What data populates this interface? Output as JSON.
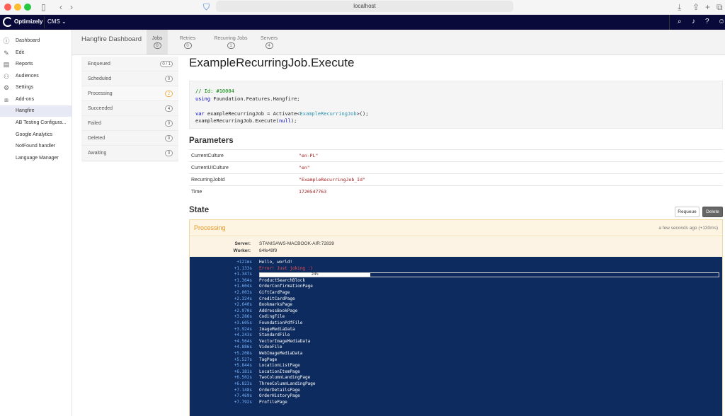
{
  "browser": {
    "address": "localhost"
  },
  "topnav": {
    "brand": "Optimizely",
    "product": "CMS"
  },
  "sidebar": {
    "items": [
      {
        "label": "Dashboard",
        "icon": "info-icon"
      },
      {
        "label": "Edit",
        "icon": "edit-icon"
      },
      {
        "label": "Reports",
        "icon": "chart-icon"
      },
      {
        "label": "Audiences",
        "icon": "people-icon"
      },
      {
        "label": "Settings",
        "icon": "gear-icon"
      },
      {
        "label": "Add-ons",
        "icon": "puzzle-icon"
      },
      {
        "label": "Hangfire",
        "icon": ""
      },
      {
        "label": "AB Testing Configura...",
        "icon": ""
      },
      {
        "label": "Google Analytics",
        "icon": ""
      },
      {
        "label": "NotFound handler",
        "icon": ""
      },
      {
        "label": "Language Manager",
        "icon": ""
      }
    ]
  },
  "hangfire": {
    "brand": "Hangfire Dashboard",
    "tabs": [
      {
        "label": "Jobs",
        "count": "0"
      },
      {
        "label": "Retries",
        "count": "0"
      },
      {
        "label": "Recurring Jobs",
        "count": "1"
      },
      {
        "label": "Servers",
        "count": "4"
      }
    ]
  },
  "jobs_menu": [
    {
      "label": "Enqueued",
      "count": "0 / 1"
    },
    {
      "label": "Scheduled",
      "count": "0"
    },
    {
      "label": "Processing",
      "count": "2"
    },
    {
      "label": "Succeeded",
      "count": "4"
    },
    {
      "label": "Failed",
      "count": "0"
    },
    {
      "label": "Deleted",
      "count": "0"
    },
    {
      "label": "Awaiting",
      "count": "0"
    }
  ],
  "job": {
    "title": "ExampleRecurringJob.Execute",
    "code": {
      "comment": "// Id: #10004",
      "using_kw": "using",
      "using_ns": " Foundation.Features.Hangfire;",
      "var_kw": "var",
      "var_rest1": " exampleRecurringJob = Activate<",
      "var_type": "ExampleRecurringJob",
      "var_rest2": ">();",
      "exec_1": "exampleRecurringJob.Execute(",
      "exec_null": "null",
      "exec_2": ");"
    },
    "parameters_heading": "Parameters",
    "parameters": [
      {
        "key": "CurrentCulture",
        "value": "\"en-PL\""
      },
      {
        "key": "CurrentUICulture",
        "value": "\"en\""
      },
      {
        "key": "RecurringJobId",
        "value": "\"ExampleRecurringJob_Id\""
      },
      {
        "key": "Time",
        "value": "1720547763"
      }
    ],
    "state_heading": "State",
    "requeue_label": "Requeue",
    "delete_label": "Delete",
    "state": {
      "name": "Processing",
      "time": "a few seconds ago (+130ms)",
      "server_label": "Server:",
      "server_value": "STANISAWS-MACBOOK-AIR:72839",
      "worker_label": "Worker:",
      "worker_value": "84fe49f9"
    },
    "console": [
      {
        "ts": "+121ms",
        "text": "Hello, world!",
        "type": "text"
      },
      {
        "ts": "+1.133s",
        "text": "Error! Just joking :)",
        "type": "error"
      },
      {
        "ts": "+1.347s",
        "text": "24%",
        "type": "progress",
        "progress": 24
      },
      {
        "ts": "+1.364s",
        "text": "ProductSearchBlock",
        "type": "text"
      },
      {
        "ts": "+1.604s",
        "text": "OrderConfirmationPage",
        "type": "text"
      },
      {
        "ts": "+2.003s",
        "text": "GiftCardPage",
        "type": "text"
      },
      {
        "ts": "+2.324s",
        "text": "CreditCardPage",
        "type": "text"
      },
      {
        "ts": "+2.640s",
        "text": "BookmarksPage",
        "type": "text"
      },
      {
        "ts": "+2.970s",
        "text": "AddressBookPage",
        "type": "text"
      },
      {
        "ts": "+3.286s",
        "text": "CodingFile",
        "type": "text"
      },
      {
        "ts": "+3.605s",
        "text": "FoundationPdfFile",
        "type": "text"
      },
      {
        "ts": "+3.924s",
        "text": "ImageMediaData",
        "type": "text"
      },
      {
        "ts": "+4.243s",
        "text": "StandardFile",
        "type": "text"
      },
      {
        "ts": "+4.564s",
        "text": "VectorImageMediaData",
        "type": "text"
      },
      {
        "ts": "+4.886s",
        "text": "VideoFile",
        "type": "text"
      },
      {
        "ts": "+5.208s",
        "text": "WebImageMediaData",
        "type": "text"
      },
      {
        "ts": "+5.527s",
        "text": "TagPage",
        "type": "text"
      },
      {
        "ts": "+5.844s",
        "text": "LocationListPage",
        "type": "text"
      },
      {
        "ts": "+6.181s",
        "text": "LocationItemPage",
        "type": "text"
      },
      {
        "ts": "+6.502s",
        "text": "TwoColumnLandingPage",
        "type": "text"
      },
      {
        "ts": "+6.823s",
        "text": "ThreeColumnLandingPage",
        "type": "text"
      },
      {
        "ts": "+7.148s",
        "text": "OrderDetailsPage",
        "type": "text"
      },
      {
        "ts": "+7.469s",
        "text": "OrderHistoryPage",
        "type": "text"
      },
      {
        "ts": "+7.792s",
        "text": "ProfilePage",
        "type": "text"
      }
    ]
  }
}
